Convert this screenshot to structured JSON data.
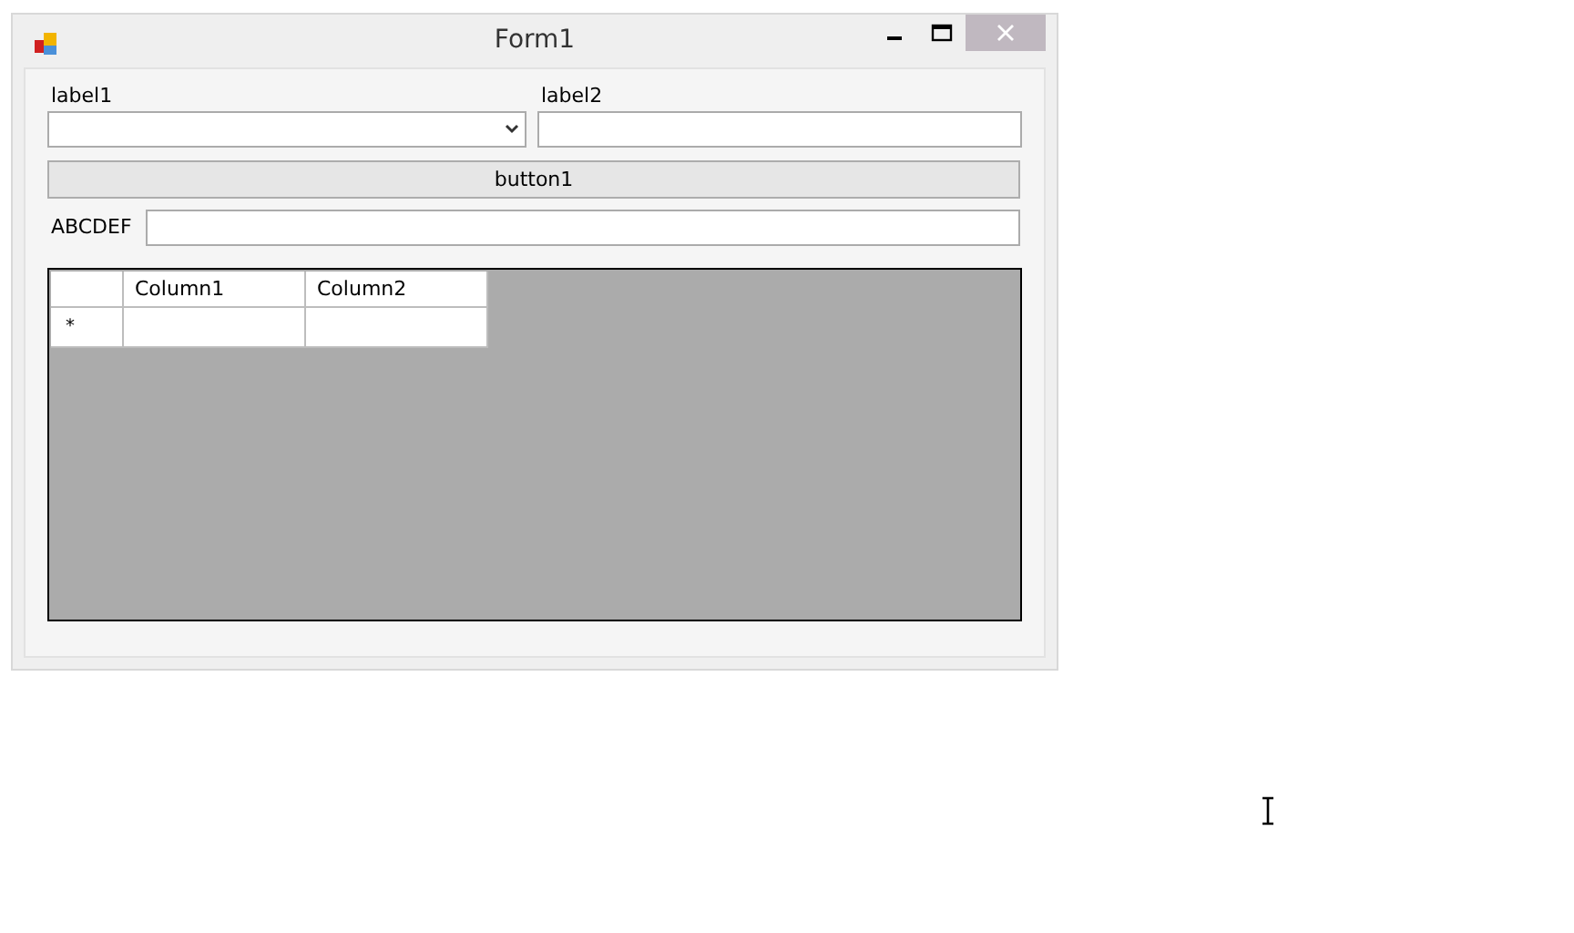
{
  "window": {
    "title": "Form1"
  },
  "label1": "label1",
  "label2": "label2",
  "button": "button1",
  "label3": "ABCDEF",
  "grid": {
    "columns": [
      "Column1",
      "Column2"
    ],
    "rows": [
      {
        "header": "*"
      }
    ]
  }
}
